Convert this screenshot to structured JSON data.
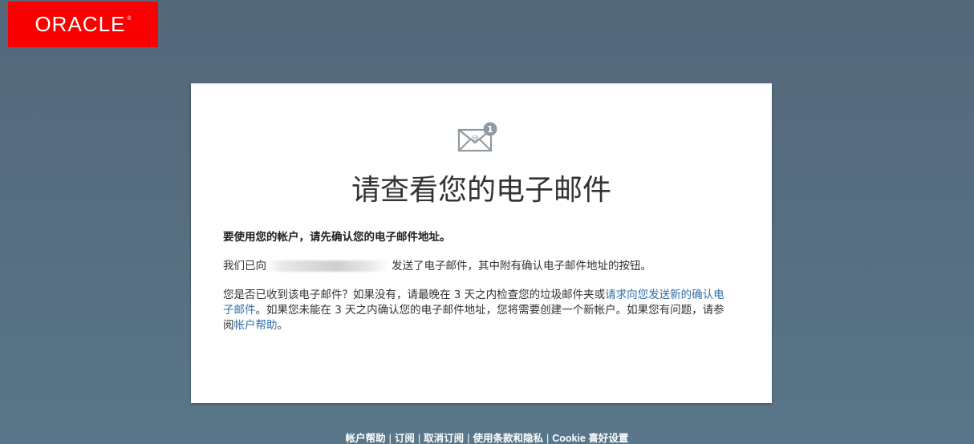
{
  "brand": {
    "logo_text": "ORACLE",
    "logo_reg": "®",
    "color": "#f80000"
  },
  "card": {
    "icon": "envelope-at-notification-icon",
    "icon_badge": "1",
    "title": "请查看您的电子邮件",
    "lead": "要使用您的帐户，请先确认您的电子邮件地址。",
    "sent_prefix": "我们已向",
    "sent_suffix": "发送了电子邮件，其中附有确认电子邮件地址的按钮。",
    "check_part1": "您是否已收到该电子邮件？如果没有，请最晚在 3 天之内检查您的垃圾邮件夹或",
    "check_link": "请求向您发送新的确认电子邮件",
    "check_part2": "。如果您未能在 3 天之内确认您的电子邮件地址，您将需要创建一个新帐户。如果您有问题，请参阅",
    "help_link": "帐户帮助",
    "check_end": "。"
  },
  "footer": {
    "links": [
      {
        "label": "帐户帮助"
      },
      {
        "label": "订阅"
      },
      {
        "label": "取消订阅"
      },
      {
        "label": "使用条款和隐私"
      },
      {
        "label": "Cookie 喜好设置"
      }
    ],
    "separator": "|"
  }
}
